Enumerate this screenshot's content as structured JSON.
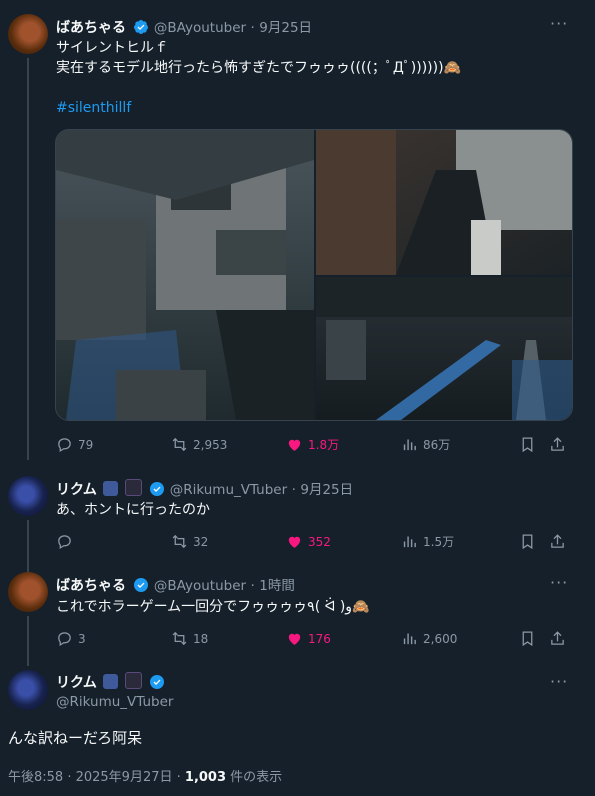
{
  "tweets": [
    {
      "name": "ばあちゃる",
      "handle": "@BAyoutuber",
      "time": "9月25日",
      "text": "サイレントヒルｆ\n実在するモデル地行ったら怖すぎたでフゥゥゥ((((；ﾟДﾟ))))))🙈",
      "hashtag": "#silenthillf",
      "stats": {
        "replies": "79",
        "retweets": "2,953",
        "likes": "1.8万",
        "views": "86万"
      }
    },
    {
      "name": "リクム",
      "handle": "@Rikumu_VTuber",
      "time": "9月25日",
      "text": "あ、ホントに行ったのか",
      "stats": {
        "replies": "",
        "retweets": "32",
        "likes": "352",
        "views": "1.5万"
      }
    },
    {
      "name": "ばあちゃる",
      "handle": "@BAyoutuber",
      "time": "1時間",
      "text": "これでホラーゲーム一回分でフゥゥゥゥ٩( ᐛ )و🙈",
      "stats": {
        "replies": "3",
        "retweets": "18",
        "likes": "176",
        "views": "2,600"
      }
    }
  ],
  "main": {
    "name": "リクム",
    "handle": "@Rikumu_VTuber",
    "text": "んな訳ねーだろ阿呆",
    "timestamp": "午後8:58 · 2025年9月27日 ·",
    "views_count": "1,003",
    "views_suffix": "件の表示"
  },
  "colors": {
    "background": "#15202b",
    "text": "#f7f9f9",
    "muted": "#8b98a5",
    "accent": "#1d9bf0",
    "like": "#f91880"
  },
  "separator": "·",
  "more_glyph": "···"
}
